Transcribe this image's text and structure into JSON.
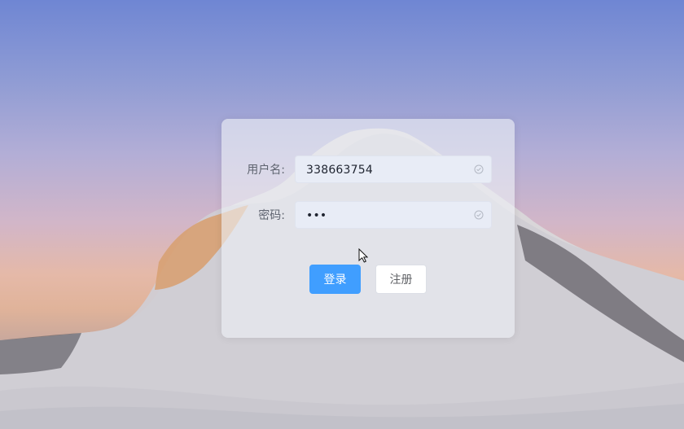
{
  "login_form": {
    "username_label": "用户名:",
    "username_value": "338663754",
    "password_label": "密码:",
    "password_value": "•••",
    "login_button": "登录",
    "register_button": "注册"
  },
  "colors": {
    "primary_button": "#409eff",
    "card_background": "rgba(238,240,245,0.62)",
    "input_background": "#e8ecf6"
  },
  "icons": {
    "input_status_icon": "circle-check-icon",
    "pointer": "mouse-cursor-icon"
  }
}
